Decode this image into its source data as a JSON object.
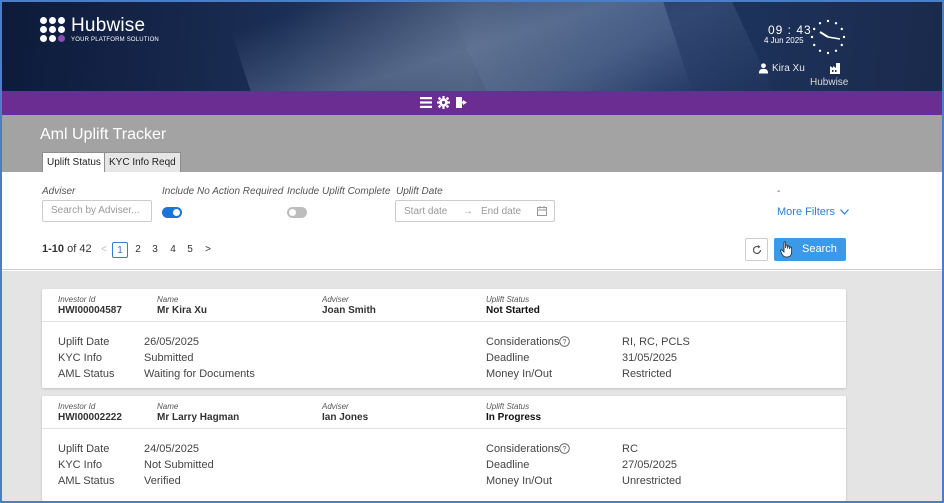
{
  "brand": {
    "name": "Hubwise",
    "tagline": "YOUR PLATFORM SOLUTION"
  },
  "header": {
    "time": "09 : 43",
    "date": "4 Jun 2025",
    "user": "Kira Xu",
    "org": "Hubwise"
  },
  "toolbar": {
    "icons": [
      "menu-icon",
      "gear-icon",
      "logout-icon"
    ]
  },
  "page": {
    "title": "Aml Uplift Tracker",
    "tabs": [
      {
        "label": "Uplift Status",
        "active": true
      },
      {
        "label": "KYC Info Reqd",
        "active": false
      }
    ]
  },
  "filters": {
    "adviser_label": "Adviser",
    "adviser_placeholder": "Search by Adviser...",
    "no_action_label": "Include No Action Required",
    "no_action_on": true,
    "complete_label": "Include Uplift Complete",
    "complete_on": false,
    "date_label": "Uplift Date",
    "start_placeholder": "Start date",
    "arrow": "→",
    "end_placeholder": "End date",
    "extra_label": "-",
    "more_filters": "More Filters"
  },
  "pager": {
    "range": "1-10",
    "of_text": "of 42",
    "prev": "<",
    "pages": [
      "1",
      "2",
      "3",
      "4",
      "5"
    ],
    "active_page": "1",
    "next": ">"
  },
  "actions": {
    "search_label": "Search"
  },
  "labels": {
    "investor_id": "Investor Id",
    "name": "Name",
    "adviser": "Adviser",
    "uplift_status": "Uplift Status",
    "uplift_date": "Uplift Date",
    "kyc_info": "KYC Info",
    "aml_status": "AML Status",
    "considerations": "Considerations",
    "deadline": "Deadline",
    "money_in_out": "Money In/Out"
  },
  "records": [
    {
      "investor_id": "HWI00004587",
      "name": "Mr Kira Xu",
      "adviser": "Joan Smith",
      "uplift_status": "Not Started",
      "uplift_date": "26/05/2025",
      "kyc_info": "Submitted",
      "aml_status": "Waiting for Documents",
      "considerations": "RI, RC, PCLS",
      "deadline": "31/05/2025",
      "money_in_out": "Restricted"
    },
    {
      "investor_id": "HWI00002222",
      "name": "Mr Larry Hagman",
      "adviser": "Ian Jones",
      "uplift_status": "In Progress",
      "uplift_date": "24/05/2025",
      "kyc_info": "Not Submitted",
      "aml_status": "Verified",
      "considerations": "RC",
      "deadline": "27/05/2025",
      "money_in_out": "Unrestricted"
    }
  ]
}
